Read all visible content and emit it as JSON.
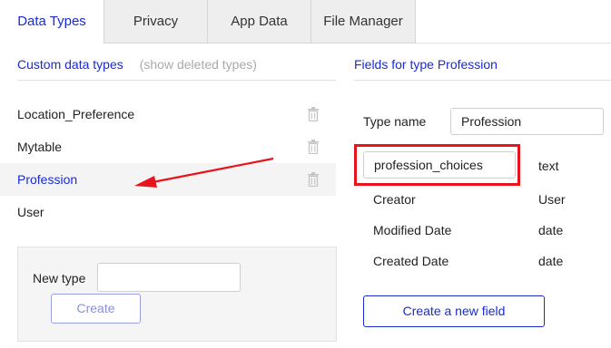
{
  "tabs": [
    {
      "label": "Data Types",
      "active": true
    },
    {
      "label": "Privacy",
      "active": false
    },
    {
      "label": "App Data",
      "active": false
    },
    {
      "label": "File Manager",
      "active": false
    }
  ],
  "left_panel": {
    "title": "Custom data types",
    "show_deleted": "(show deleted types)",
    "types": [
      {
        "label": "Location_Preference",
        "selected": false,
        "icon": "trash-icon"
      },
      {
        "label": "Mytable",
        "selected": false,
        "icon": "trash-icon"
      },
      {
        "label": "Profession",
        "selected": true,
        "icon": "trash-icon"
      },
      {
        "label": "User",
        "selected": false
      }
    ],
    "new_type_label": "New type",
    "new_type_value": "",
    "create_label": "Create"
  },
  "right_panel": {
    "title": "Fields for type Profession",
    "type_name_label": "Type name",
    "type_name_value": "Profession",
    "fields": [
      {
        "name": "profession_choices",
        "type": "text",
        "editing": true
      },
      {
        "name": "Creator",
        "type": "User"
      },
      {
        "name": "Modified Date",
        "type": "date"
      },
      {
        "name": "Created Date",
        "type": "date"
      }
    ],
    "new_field_label": "Create a new field"
  },
  "colors": {
    "accent": "#1a2bd6",
    "annotation": "#e8131b",
    "tab_bg": "#eeeeee",
    "selected_row_bg": "#f4f4f4"
  }
}
